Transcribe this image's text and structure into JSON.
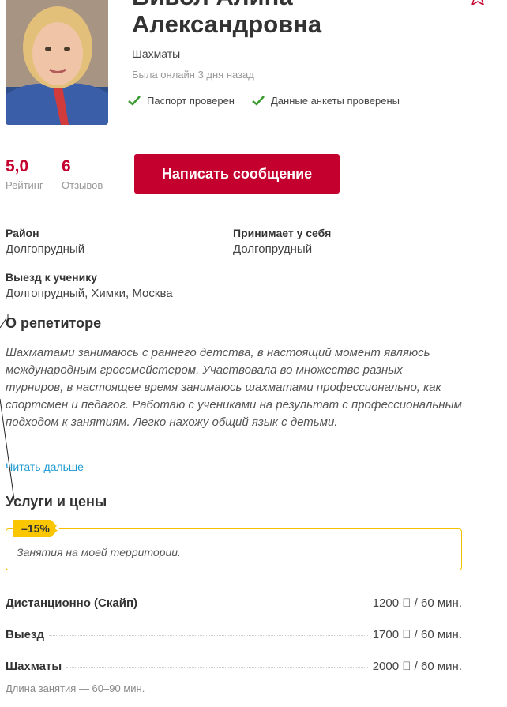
{
  "profile": {
    "name_line1": "Бивол Алина",
    "name_line2": "Александровна",
    "subject": "Шахматы",
    "online_status": "Была онлайн 3 дня назад",
    "checks": [
      "Паспорт проверен",
      "Данные анкеты проверены"
    ]
  },
  "metrics": {
    "rating_value": "5,0",
    "rating_label": "Рейтинг",
    "reviews_value": "6",
    "reviews_label": "Отзывов"
  },
  "actions": {
    "write_message": "Написать сообщение"
  },
  "location": {
    "district_label": "Район",
    "district_value": "Долгопрудный",
    "home_label": "Принимает у себя",
    "home_value": "Долгопрудный",
    "visit_label": "Выезд к ученику",
    "visit_value": "Долгопрудный, Химки, Москва"
  },
  "about": {
    "title": "О репетиторе",
    "text": "Шахматами занимаюсь с раннего детства, в настоящий момент являюсь международным гроссмейстером. Участвовала во множестве разных турниров, в настоящее время занимаюсь шахматами профессионально, как спортсмен и педагог. Работаю с учениками на результат с профессиональным подходом к занятиям. Легко нахожу общий язык с детьми.",
    "read_more": "Читать дальше"
  },
  "services": {
    "title": "Услуги и цены",
    "promo_badge": "–15%",
    "promo_text": "Занятия на моей территории.",
    "items": [
      {
        "name": "Дистанционно (Скайп)",
        "price": "1200 ⃝ / 60 мин."
      },
      {
        "name": "Выезд",
        "price": "1700 ⃝ / 60 мин."
      },
      {
        "name": "Шахматы",
        "price": "2000 ⃝ / 60 мин."
      }
    ],
    "duration_note": "Длина занятия — 60–90 мин."
  },
  "colors": {
    "accent": "#c4002e",
    "link": "#1f9bd1",
    "promo": "#f9c600",
    "check": "#3a9b2f"
  }
}
